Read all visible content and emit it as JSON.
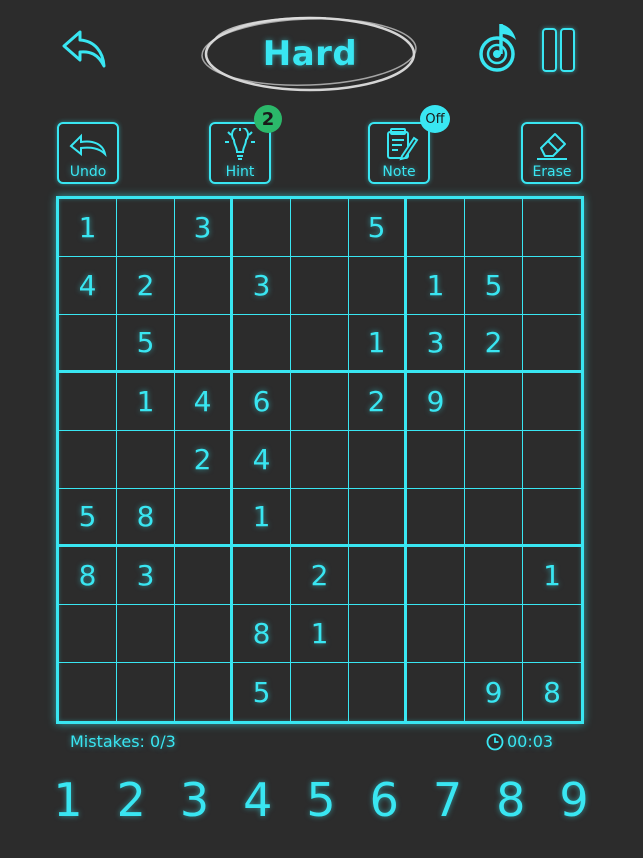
{
  "header": {
    "title": "Hard",
    "back_icon": "back-arrow-icon",
    "music_icon": "music-note-icon",
    "pause_icon": "pause-icon"
  },
  "toolbar": {
    "undo": {
      "label": "Undo",
      "icon": "undo-arrow-icon"
    },
    "hint": {
      "label": "Hint",
      "icon": "lightbulb-icon",
      "badge": "2"
    },
    "note": {
      "label": "Note",
      "icon": "notepad-pencil-icon",
      "badge": "Off"
    },
    "erase": {
      "label": "Erase",
      "icon": "eraser-icon"
    }
  },
  "board": {
    "rows": [
      [
        "1",
        "",
        "3",
        "",
        "",
        "5",
        "",
        "",
        ""
      ],
      [
        "4",
        "2",
        "",
        "3",
        "",
        "",
        "1",
        "5",
        ""
      ],
      [
        "",
        "5",
        "",
        "",
        "",
        "1",
        "3",
        "2",
        ""
      ],
      [
        "",
        "1",
        "4",
        "6",
        "",
        "2",
        "9",
        "",
        ""
      ],
      [
        "",
        "",
        "2",
        "4",
        "",
        "",
        "",
        "",
        ""
      ],
      [
        "5",
        "8",
        "",
        "1",
        "",
        "",
        "",
        "",
        ""
      ],
      [
        "8",
        "3",
        "",
        "",
        "2",
        "",
        "",
        "",
        "1"
      ],
      [
        "",
        "",
        "",
        "8",
        "1",
        "",
        "",
        "",
        ""
      ],
      [
        "",
        "",
        "",
        "5",
        "",
        "",
        "",
        "9",
        "8"
      ]
    ]
  },
  "status": {
    "mistakes": "Mistakes: 0/3",
    "timer": "00:03",
    "timer_icon": "clock-icon"
  },
  "numpad": [
    "1",
    "2",
    "3",
    "4",
    "5",
    "6",
    "7",
    "8",
    "9"
  ],
  "colors": {
    "background": "#2c2c2c",
    "accent": "#39e6f2",
    "hint_badge": "#2bb86a"
  }
}
